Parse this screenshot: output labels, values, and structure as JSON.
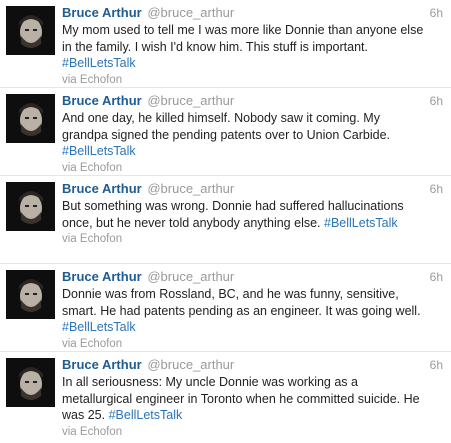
{
  "tweets": [
    {
      "name": "Bruce Arthur",
      "handle": "@bruce_arthur",
      "time": "6h",
      "text": "My mom used to tell me I was more like Donnie than anyone else in the family. I wish I'd know him. This stuff is important.",
      "hashtag": "#BellLetsTalk",
      "source": "via Echofon"
    },
    {
      "name": "Bruce Arthur",
      "handle": "@bruce_arthur",
      "time": "6h",
      "text": "And one day, he killed himself. Nobody saw it coming. My grandpa signed the pending patents over to Union Carbide.",
      "hashtag": "#BellLetsTalk",
      "source": "via Echofon"
    },
    {
      "name": "Bruce Arthur",
      "handle": "@bruce_arthur",
      "time": "6h",
      "text": "But something was wrong. Donnie had suffered hallucinations once, but he never told anybody anything else.",
      "hashtag": "#BellLetsTalk",
      "source": "via Echofon"
    },
    {
      "name": "Bruce Arthur",
      "handle": "@bruce_arthur",
      "time": "6h",
      "text": "Donnie was from Rossland, BC, and he was funny, sensitive, smart. He had patents pending as an engineer. It was going well.",
      "hashtag": "#BellLetsTalk",
      "source": "via Echofon"
    },
    {
      "name": "Bruce Arthur",
      "handle": "@bruce_arthur",
      "time": "6h",
      "text": "In all seriousness: My uncle Donnie was working as a metallurgical engineer in Toronto when he committed suicide. He was 25.",
      "hashtag": "#BellLetsTalk",
      "source": "via Echofon"
    }
  ],
  "colors": {
    "name": "#1f5c95",
    "hashtag": "#2b74b8",
    "muted": "#9a9a9a"
  }
}
